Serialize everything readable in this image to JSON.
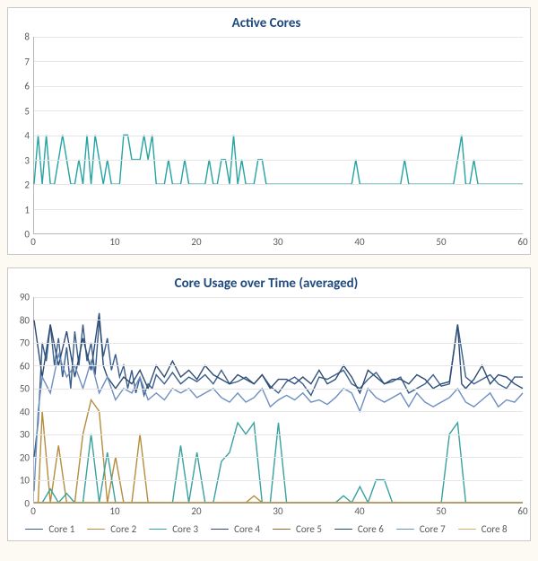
{
  "chart_data": [
    {
      "id": "active_cores",
      "type": "line",
      "title": "Active Cores",
      "xlim": [
        0,
        60
      ],
      "ylim": [
        0,
        8
      ],
      "x_ticks": [
        0,
        10,
        20,
        30,
        40,
        50,
        60
      ],
      "y_ticks": [
        0,
        1,
        2,
        3,
        4,
        5,
        6,
        7,
        8
      ],
      "series": [
        {
          "name": "Active Cores",
          "color": "#26a3a3",
          "x": [
            0,
            0.5,
            1,
            1.5,
            2,
            2.5,
            3,
            3.5,
            4,
            4.5,
            5,
            5.5,
            6,
            6.5,
            7,
            7.5,
            8,
            8.5,
            9,
            9.5,
            10,
            10.5,
            11,
            11.5,
            12,
            12.5,
            13,
            13.5,
            14,
            14.5,
            15,
            15.5,
            16,
            16.5,
            17,
            17.5,
            18,
            18.5,
            19,
            19.5,
            20,
            20.5,
            21,
            21.5,
            22,
            22.5,
            23,
            23.5,
            24,
            24.5,
            25,
            25.5,
            26,
            26.5,
            27,
            27.5,
            28,
            28.5,
            29,
            29.5,
            30,
            30.5,
            31,
            31.5,
            32,
            32.5,
            33,
            33.5,
            34,
            34.5,
            35,
            35.5,
            36,
            36.5,
            37,
            37.5,
            38,
            38.5,
            39,
            39.5,
            40,
            40.5,
            41,
            41.5,
            42,
            42.5,
            43,
            43.5,
            44,
            44.5,
            45,
            45.5,
            46,
            46.5,
            47,
            47.5,
            48,
            48.5,
            49,
            49.5,
            50,
            50.5,
            51,
            51.5,
            52,
            52.5,
            53,
            53.5,
            54,
            54.5,
            55,
            55.5,
            56,
            56.5,
            57,
            57.5,
            58,
            58.5,
            59,
            59.5,
            60
          ],
          "values": [
            2,
            4,
            2,
            4,
            2,
            2,
            3,
            4,
            3,
            2,
            2,
            3,
            2,
            4,
            2,
            4,
            3,
            2,
            3,
            2,
            2,
            2,
            4,
            4,
            3,
            3,
            3,
            4,
            3,
            4,
            2,
            2,
            2,
            3,
            2,
            2,
            2,
            3,
            2,
            2,
            2,
            2,
            2,
            3,
            2,
            2,
            3,
            3,
            2,
            4,
            2,
            3,
            2,
            2,
            2,
            3,
            3,
            2,
            2,
            2,
            2,
            2,
            2,
            2,
            2,
            2,
            2,
            2,
            2,
            2,
            2,
            2,
            2,
            2,
            2,
            2,
            2,
            2,
            2,
            3,
            2,
            2,
            2,
            2,
            2,
            2,
            2,
            2,
            2,
            2,
            2,
            3,
            2,
            2,
            2,
            2,
            2,
            2,
            2,
            2,
            2,
            2,
            2,
            2,
            3,
            4,
            2,
            2,
            3,
            2,
            2,
            2,
            2,
            2,
            2,
            2,
            2,
            2,
            2,
            2,
            2
          ]
        }
      ]
    },
    {
      "id": "core_usage",
      "type": "line",
      "title": "Core Usage over Time (averaged)",
      "xlim": [
        0,
        60
      ],
      "ylim": [
        0,
        90
      ],
      "x_ticks": [
        0,
        10,
        20,
        30,
        40,
        50,
        60
      ],
      "y_ticks": [
        0,
        10,
        20,
        30,
        40,
        50,
        60,
        70,
        80,
        90
      ],
      "legend": [
        "Core 1",
        "Core 2",
        "Core 3",
        "Core 4",
        "Core 5",
        "Core 6",
        "Core 7",
        "Core 8"
      ],
      "series": [
        {
          "name": "Core 1",
          "color": "#3a5e8c",
          "x": [
            0,
            0.5,
            1,
            1.5,
            2,
            2.5,
            3,
            3.5,
            4,
            4.5,
            5,
            5.5,
            6,
            6.5,
            7,
            7.5,
            8,
            8.5,
            9,
            9.5,
            10,
            10.5,
            11,
            11.5,
            12,
            12.5,
            13,
            13.5,
            14,
            14.5,
            15,
            16,
            17,
            18,
            19,
            20,
            21,
            22,
            23,
            24,
            25,
            26,
            27,
            28,
            29,
            30,
            31,
            32,
            33,
            34,
            35,
            36,
            37,
            38,
            39,
            40,
            41,
            42,
            43,
            44,
            45,
            46,
            47,
            48,
            49,
            50,
            51,
            52,
            53,
            54,
            55,
            56,
            57,
            58,
            59,
            60
          ],
          "values": [
            20,
            35,
            70,
            62,
            78,
            60,
            72,
            55,
            68,
            50,
            75,
            60,
            78,
            62,
            70,
            56,
            80,
            64,
            72,
            58,
            65,
            55,
            60,
            50,
            58,
            48,
            55,
            47,
            52,
            50,
            56,
            52,
            57,
            52,
            55,
            53,
            56,
            52,
            58,
            52,
            53,
            55,
            52,
            56,
            51,
            48,
            53,
            55,
            52,
            47,
            55,
            54,
            56,
            58,
            52,
            50,
            54,
            57,
            52,
            53,
            55,
            48,
            50,
            52,
            56,
            51,
            52,
            78,
            55,
            52,
            54,
            56,
            52,
            50,
            55,
            55
          ]
        },
        {
          "name": "Core 2",
          "color": "#b58d3d",
          "x": [
            0,
            0.5,
            1,
            2,
            3,
            4,
            5,
            6,
            7,
            8,
            9,
            10,
            11,
            12,
            13,
            14,
            15,
            16,
            17,
            18,
            20,
            22,
            24,
            26,
            27,
            28,
            29,
            30,
            32,
            40,
            50,
            51,
            52,
            53,
            54,
            60
          ],
          "values": [
            0,
            0,
            40,
            0,
            25,
            0,
            0,
            30,
            45,
            40,
            0,
            20,
            0,
            0,
            30,
            0,
            0,
            0,
            0,
            0,
            0,
            0,
            0,
            0,
            3,
            0,
            0,
            0,
            0,
            0,
            0,
            0,
            0,
            0,
            0,
            0
          ]
        },
        {
          "name": "Core 3",
          "color": "#3aa0a0",
          "x": [
            0,
            1,
            2,
            3,
            4,
            5,
            6,
            7,
            8,
            9,
            10,
            11,
            12,
            13,
            14,
            15,
            16,
            17,
            18,
            19,
            20,
            21,
            22,
            23,
            24,
            25,
            26,
            27,
            28,
            29,
            30,
            31,
            32,
            33,
            34,
            35,
            36,
            37,
            38,
            39,
            40,
            41,
            42,
            43,
            44,
            45,
            46,
            47,
            48,
            49,
            50,
            51,
            52,
            53,
            54,
            55,
            56,
            57,
            58,
            59,
            60
          ],
          "values": [
            0,
            0,
            6,
            0,
            4,
            0,
            0,
            30,
            0,
            22,
            0,
            0,
            0,
            0,
            0,
            0,
            0,
            0,
            25,
            0,
            22,
            0,
            0,
            18,
            22,
            35,
            30,
            35,
            0,
            0,
            35,
            0,
            0,
            0,
            0,
            0,
            0,
            0,
            3,
            0,
            7,
            0,
            10,
            10,
            0,
            0,
            0,
            0,
            0,
            0,
            0,
            30,
            35,
            0,
            0,
            0,
            0,
            0,
            0,
            0,
            0
          ]
        },
        {
          "name": "Core 4",
          "color": "#2e4c73",
          "x": [
            0,
            1,
            2,
            3,
            4,
            5,
            6,
            7,
            8,
            8.5,
            9,
            10,
            11,
            12,
            13,
            14,
            15,
            16,
            17,
            18,
            19,
            20,
            21,
            22,
            23,
            24,
            25,
            26,
            27,
            28,
            29,
            30,
            31,
            32,
            33,
            34,
            35,
            36,
            37,
            38,
            39,
            40,
            41,
            42,
            43,
            44,
            45,
            46,
            47,
            48,
            49,
            50,
            51,
            52,
            52.5,
            53,
            54,
            55,
            56,
            57,
            58,
            59,
            60
          ],
          "values": [
            80,
            55,
            78,
            60,
            75,
            55,
            72,
            58,
            83,
            60,
            55,
            50,
            55,
            52,
            58,
            50,
            60,
            55,
            62,
            55,
            58,
            54,
            60,
            56,
            54,
            52,
            56,
            54,
            52,
            56,
            50,
            54,
            54,
            52,
            55,
            52,
            58,
            52,
            54,
            60,
            55,
            48,
            58,
            55,
            52,
            54,
            54,
            52,
            56,
            54,
            50,
            52,
            53,
            78,
            52,
            50,
            54,
            60,
            52,
            56,
            55,
            52,
            50
          ]
        },
        {
          "name": "Core 5",
          "color": "#8c6a2f",
          "x": [
            0,
            2,
            4,
            6,
            8,
            10,
            60
          ],
          "values": [
            0,
            0,
            0,
            0,
            0,
            0,
            0
          ]
        },
        {
          "name": "Core 6",
          "color": "#264764",
          "x": [
            0,
            2,
            4,
            6,
            8,
            10,
            60
          ],
          "values": [
            0,
            0,
            0,
            0,
            0,
            0,
            0
          ]
        },
        {
          "name": "Core 7",
          "color": "#6d8fbf",
          "x": [
            0,
            0.5,
            1,
            2,
            3,
            4,
            5,
            6,
            7,
            8,
            9,
            10,
            11,
            12,
            13,
            14,
            15,
            16,
            17,
            18,
            19,
            20,
            21,
            22,
            23,
            24,
            25,
            26,
            27,
            28,
            29,
            30,
            31,
            32,
            33,
            34,
            35,
            36,
            37,
            38,
            39,
            40,
            41,
            42,
            43,
            44,
            45,
            46,
            47,
            48,
            49,
            50,
            51,
            52,
            53,
            54,
            55,
            56,
            57,
            58,
            59,
            60
          ],
          "values": [
            5,
            40,
            55,
            48,
            65,
            55,
            60,
            50,
            62,
            48,
            55,
            45,
            50,
            48,
            55,
            45,
            48,
            45,
            50,
            48,
            50,
            46,
            48,
            50,
            46,
            44,
            48,
            44,
            46,
            50,
            42,
            45,
            47,
            45,
            48,
            44,
            45,
            43,
            46,
            50,
            48,
            40,
            50,
            46,
            44,
            46,
            48,
            42,
            48,
            44,
            42,
            44,
            46,
            50,
            44,
            42,
            45,
            48,
            42,
            45,
            44,
            48
          ]
        },
        {
          "name": "Core 8",
          "color": "#d2b06a",
          "x": [
            0,
            2,
            4,
            6,
            8,
            10,
            60
          ],
          "values": [
            0,
            0,
            0,
            0,
            0,
            0,
            0
          ]
        }
      ]
    }
  ]
}
